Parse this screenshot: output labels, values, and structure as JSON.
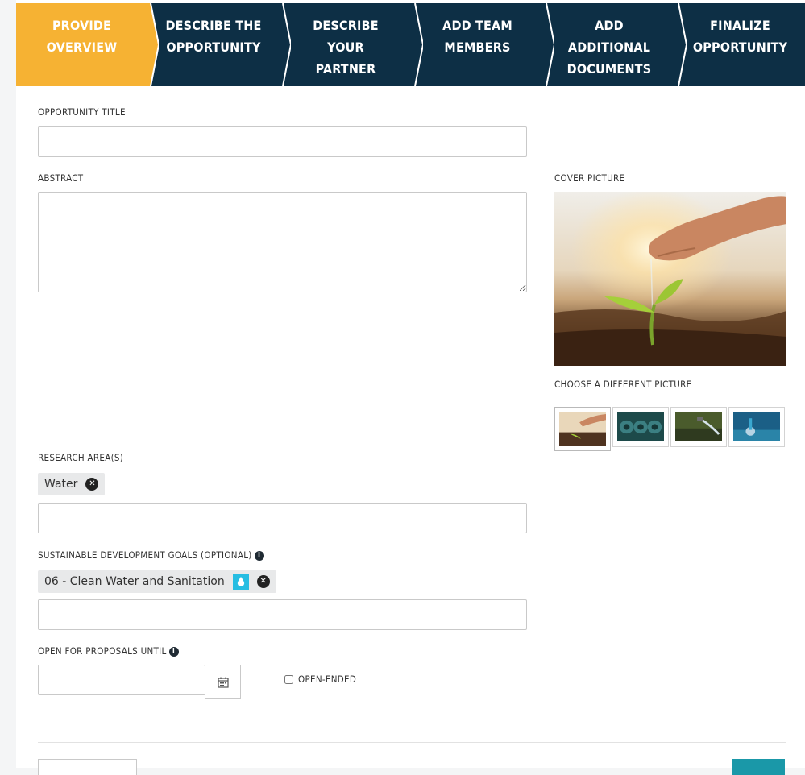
{
  "wizard": {
    "steps": [
      {
        "line1": "PROVIDE",
        "line2": "OVERVIEW",
        "line3": ""
      },
      {
        "line1": "DESCRIBE THE",
        "line2": "OPPORTUNITY",
        "line3": ""
      },
      {
        "line1": "DESCRIBE",
        "line2": "YOUR",
        "line3": "PARTNER"
      },
      {
        "line1": "ADD TEAM",
        "line2": "MEMBERS",
        "line3": ""
      },
      {
        "line1": "ADD",
        "line2": "ADDITIONAL",
        "line3": "DOCUMENTS"
      },
      {
        "line1": "FINALIZE",
        "line2": "OPPORTUNITY",
        "line3": ""
      }
    ],
    "active_index": 0,
    "colors": {
      "active": "#f6b233",
      "inactive": "#0d2f45"
    }
  },
  "form": {
    "title_label": "OPPORTUNITY TITLE",
    "title_value": "",
    "abstract_label": "ABSTRACT",
    "abstract_value": "",
    "research_label": "RESEARCH AREA(S)",
    "research_tags": [
      "Water"
    ],
    "research_input_value": "",
    "sdg_label": "SUSTAINABLE DEVELOPMENT GOALS (OPTIONAL)",
    "sdg_tags": [
      "06 - Clean Water and Sanitation"
    ],
    "sdg_input_value": "",
    "deadline_label": "OPEN FOR PROPOSALS UNTIL",
    "deadline_value": "",
    "open_ended_label": "OPEN-ENDED",
    "open_ended_checked": false
  },
  "cover": {
    "label": "COVER PICTURE",
    "choose_label": "CHOOSE A DIFFERENT PICTURE",
    "selected_index": 0
  },
  "icons": {
    "info": "info-icon",
    "remove": "close-circle-icon",
    "calendar": "calendar-icon",
    "sdg": "water-drop-icon"
  },
  "colors": {
    "accent_teal": "#1a98a8",
    "sdg6": "#26bde2"
  }
}
